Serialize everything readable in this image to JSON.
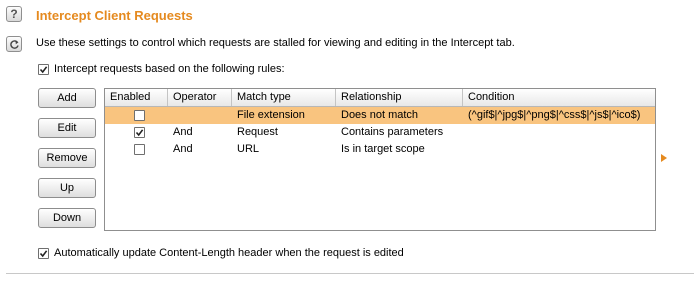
{
  "panel": {
    "title": "Intercept Client Requests",
    "description": "Use these settings to control which requests are stalled for viewing and editing in the Intercept tab.",
    "intercept_rules": {
      "label": "Intercept requests based on the following rules:",
      "checked": true
    },
    "auto_update": {
      "label": "Automatically update Content-Length header when the request is edited",
      "checked": true
    }
  },
  "side_buttons": [
    {
      "icon": "help-icon",
      "glyph": "?"
    },
    {
      "icon": "refresh-icon"
    }
  ],
  "buttons": [
    "Add",
    "Edit",
    "Remove",
    "Up",
    "Down"
  ],
  "table": {
    "columns": [
      "Enabled",
      "Operator",
      "Match type",
      "Relationship",
      "Condition"
    ],
    "rows": [
      {
        "enabled": false,
        "operator": "",
        "match_type": "File extension",
        "relationship": "Does not match",
        "condition": "(^gif$|^jpg$|^png$|^css$|^js$|^ico$)",
        "selected": true
      },
      {
        "enabled": true,
        "operator": "And",
        "match_type": "Request",
        "relationship": "Contains parameters",
        "condition": "",
        "selected": false
      },
      {
        "enabled": false,
        "operator": "And",
        "match_type": "URL",
        "relationship": "Is in target scope",
        "condition": "",
        "selected": false
      }
    ]
  },
  "colors": {
    "accent": "#e58a1f",
    "selected_row": "#f9c47f"
  }
}
